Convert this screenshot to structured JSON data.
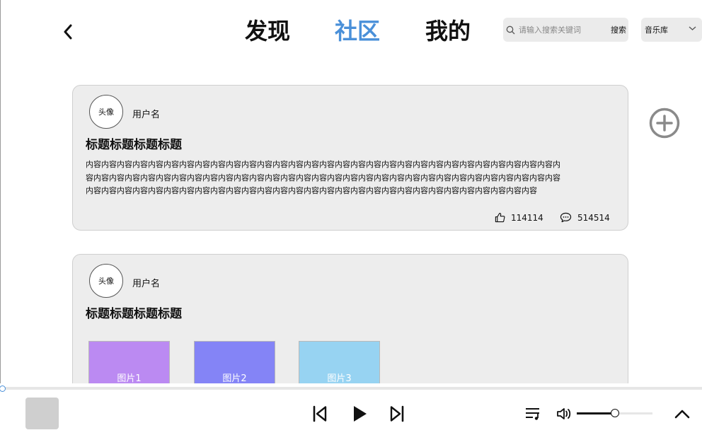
{
  "header": {
    "tabs": [
      {
        "label": "发现",
        "active": false
      },
      {
        "label": "社区",
        "active": true
      },
      {
        "label": "我的",
        "active": false
      }
    ],
    "search": {
      "placeholder": "请输入搜索关键词",
      "button_label": "搜索"
    },
    "library_select": {
      "selected": "音乐库"
    }
  },
  "posts": [
    {
      "avatar_label": "头像",
      "username": "用户名",
      "title": "标题标题标题标题",
      "content": "内容内容内容内容内容内容内容内容内容内容内容内容内容内容内容内容内容内容内容内容内容内容内容内容内容内容内容内容内容内容内容内容内容内容内容内容内容内容内容内容内容内容内容内容内容内容内容内容内容内容内容内容内容内容内容内容内容内容内容内容内容内容内容内容内容内容内容内容内容内容内容内容内容内容内容内容内容内容内容内容内容内容内容内容内容内容内容内容内容内容",
      "likes": "114114",
      "comments": "514514"
    },
    {
      "avatar_label": "头像",
      "username": "用户名",
      "title": "标题标题标题标题",
      "images": [
        "图片1",
        "图片2",
        "图片3"
      ]
    }
  ],
  "player": {
    "progress": 0.0,
    "volume": 0.5
  },
  "colors": {
    "accent": "#4a90d9",
    "card_bg": "#ededed",
    "image1": "#bb8af2",
    "image2": "#8484f6",
    "image3": "#97d3f2"
  },
  "icons": [
    "back-icon",
    "search-icon",
    "chevron-down-icon",
    "add-circle-icon",
    "thumbs-up-icon",
    "comment-icon",
    "previous-icon",
    "play-icon",
    "next-icon",
    "playlist-icon",
    "volume-icon",
    "chevron-up-icon"
  ]
}
